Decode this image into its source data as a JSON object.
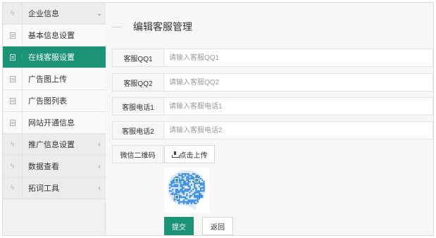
{
  "sidebar": {
    "items": [
      {
        "label": "企业信息",
        "icon": "bolt-icon",
        "expanded": true
      },
      {
        "label": "基本信息设置",
        "icon": "document-icon"
      },
      {
        "label": "在线客服设置",
        "icon": "document-icon",
        "active": true
      },
      {
        "label": "广告图上传",
        "icon": "document-icon"
      },
      {
        "label": "广告图列表",
        "icon": "document-icon"
      },
      {
        "label": "网站开通信息",
        "icon": "document-icon"
      },
      {
        "label": "推广信息设置",
        "icon": "bolt-icon"
      },
      {
        "label": "数据查看",
        "icon": "bolt-icon"
      },
      {
        "label": "拓词工具",
        "icon": "bolt-icon"
      }
    ]
  },
  "main": {
    "title": "编辑客服管理",
    "fields": [
      {
        "label": "客服QQ1",
        "placeholder": "请输入客服QQ1",
        "value": ""
      },
      {
        "label": "客服QQ2",
        "placeholder": "请输入客服QQ2",
        "value": ""
      },
      {
        "label": "客服电话1",
        "placeholder": "请输入客服电话1",
        "value": ""
      },
      {
        "label": "客服电话2",
        "placeholder": "请输入客服电话2",
        "value": ""
      }
    ],
    "qr_label": "微信二维码",
    "upload_label": "点击上传",
    "submit_label": "提交",
    "back_label": "返回"
  },
  "colors": {
    "accent": "#1b9475",
    "qr_blue": "#3a8ee6"
  }
}
